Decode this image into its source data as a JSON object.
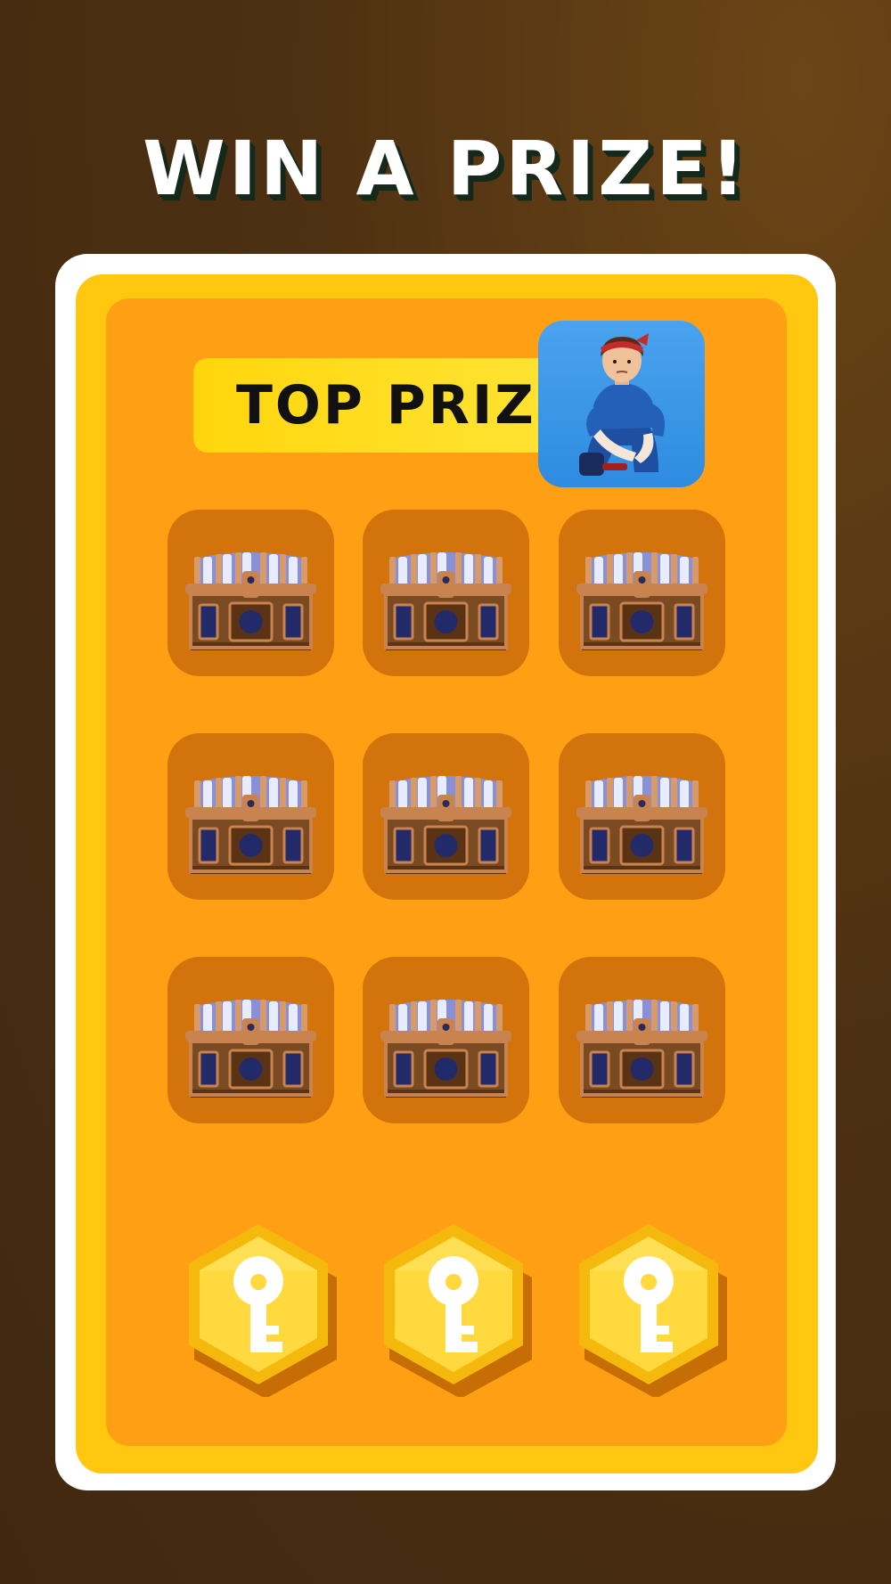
{
  "header": {
    "title": "WIN A PRIZE!"
  },
  "top_prize": {
    "label": "TOP PRIZE",
    "image_icon": "character-avatar"
  },
  "chests": [
    {
      "icon": "treasure-chest-icon"
    },
    {
      "icon": "treasure-chest-icon"
    },
    {
      "icon": "treasure-chest-icon"
    },
    {
      "icon": "treasure-chest-icon"
    },
    {
      "icon": "treasure-chest-icon"
    },
    {
      "icon": "treasure-chest-icon"
    },
    {
      "icon": "treasure-chest-icon"
    },
    {
      "icon": "treasure-chest-icon"
    },
    {
      "icon": "treasure-chest-icon"
    }
  ],
  "keys": {
    "count": 3,
    "icon": "key-icon"
  },
  "colors": {
    "background": "#4d3012",
    "card_border": "#ffffff",
    "card_yellow": "#ffc70f",
    "card_orange": "#ff9f14",
    "slot": "#d2730b",
    "banner": "#ffd60c",
    "key_gold": "#ffd21f"
  }
}
